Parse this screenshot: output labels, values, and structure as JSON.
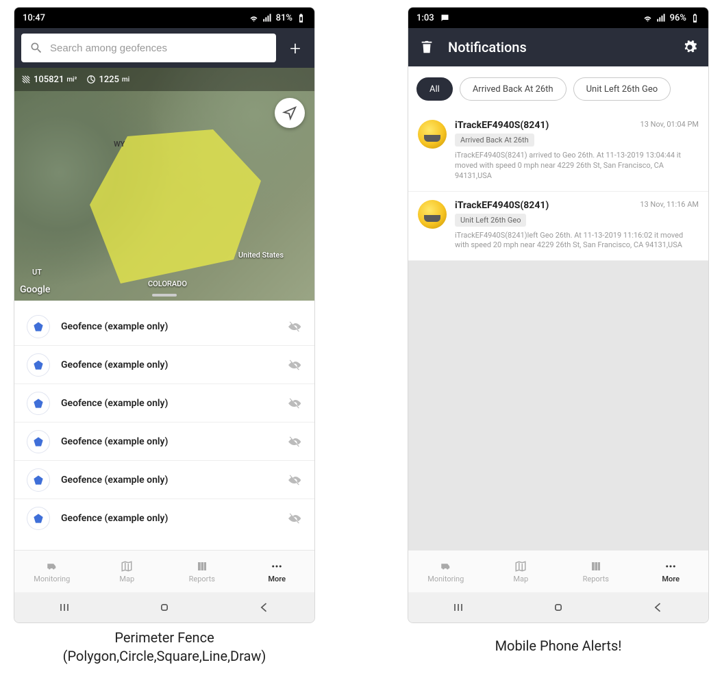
{
  "left": {
    "status": {
      "time": "10:47",
      "battery": "81%"
    },
    "search_placeholder": "Search among geofences",
    "metrics": {
      "area": "105821",
      "area_unit": "mi²",
      "perimeter": "1225",
      "perimeter_unit": "mi"
    },
    "map_labels": {
      "wy": "WY",
      "ut": "UT",
      "us": "United States",
      "co": "COLORADO",
      "google": "Google"
    },
    "geofences": [
      {
        "label": "Geofence (example only)"
      },
      {
        "label": "Geofence (example only)"
      },
      {
        "label": "Geofence (example only)"
      },
      {
        "label": "Geofence (example only)"
      },
      {
        "label": "Geofence (example only)"
      },
      {
        "label": "Geofence (example only)"
      }
    ],
    "nav": {
      "monitoring": "Monitoring",
      "map": "Map",
      "reports": "Reports",
      "more": "More"
    },
    "caption_line1": "Perimeter Fence",
    "caption_line2": "(Polygon,Circle,Square,Line,Draw)"
  },
  "right": {
    "status": {
      "time": "1:03",
      "battery": "96%"
    },
    "title": "Notifications",
    "filters": {
      "all": "All",
      "f1": "Arrived Back At 26th",
      "f2": "Unit Left 26th Geo"
    },
    "cards": [
      {
        "title": "iTrackEF4940S(8241)",
        "time": "13 Nov, 01:04 PM",
        "tag": "Arrived Back At 26th",
        "desc": "iTrackEF4940S(8241) arrived to Geo 26th.    At 11-13-2019 13:04:44 it moved with speed 0 mph near 4229 26th St, San Francisco, CA 94131,USA"
      },
      {
        "title": "iTrackEF4940S(8241)",
        "time": "13 Nov, 11:16 AM",
        "tag": "Unit Left 26th Geo",
        "desc": "iTrackEF4940S(8241)left Geo 26th.    At 11-13-2019 11:16:02 it moved with speed 20 mph near 4229 26th St, San Francisco, CA 94131,USA"
      }
    ],
    "nav": {
      "monitoring": "Monitoring",
      "map": "Map",
      "reports": "Reports",
      "more": "More"
    },
    "caption": "Mobile Phone Alerts!"
  }
}
